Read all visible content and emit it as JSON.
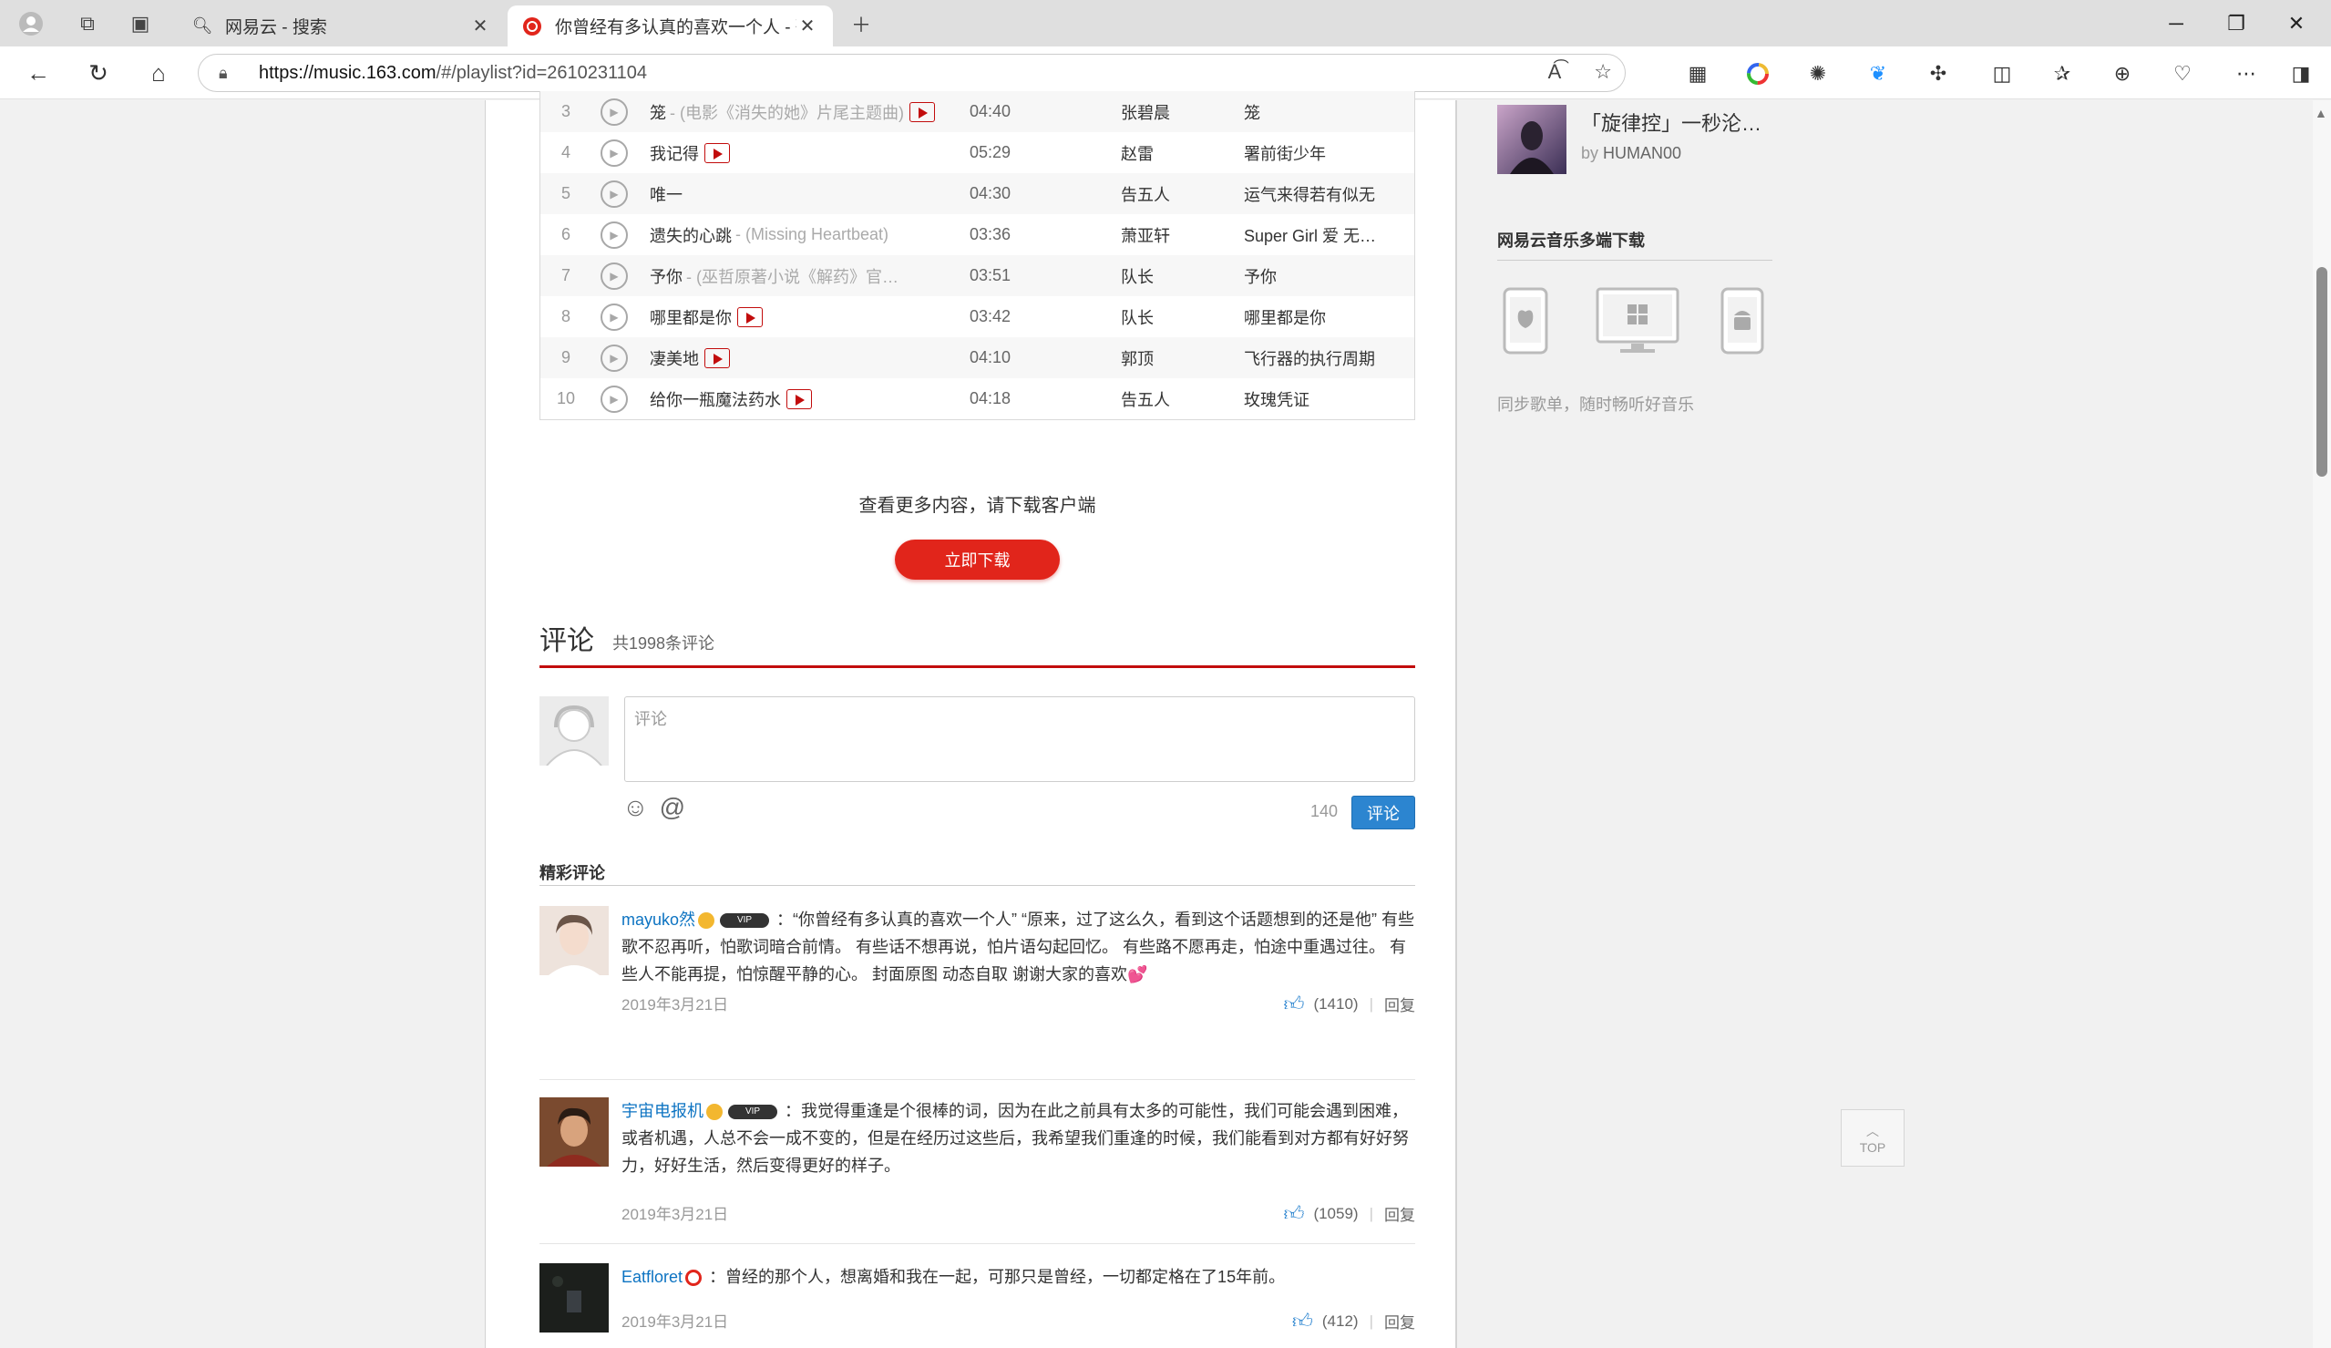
{
  "browser": {
    "tabs": [
      {
        "title": "网易云 - 搜索",
        "icon": "search-icon",
        "active": false
      },
      {
        "title": "你曾经有多认真的喜欢一个人 - 歌",
        "icon": "netease-logo-icon",
        "active": true
      }
    ],
    "url_host": "https://music.163.com",
    "url_rest": "/#/playlist?id=2610231104"
  },
  "songs": [
    {
      "num": "3",
      "title": "笼",
      "alias": "- (电影《消失的她》片尾主题曲)",
      "mv": true,
      "duration": "04:40",
      "artist": "张碧晨",
      "album": "笼"
    },
    {
      "num": "4",
      "title": "我记得",
      "alias": "",
      "mv": true,
      "duration": "05:29",
      "artist": "赵雷",
      "album": "署前街少年"
    },
    {
      "num": "5",
      "title": "唯一",
      "alias": "",
      "mv": false,
      "duration": "04:30",
      "artist": "告五人",
      "album": "运气来得若有似无"
    },
    {
      "num": "6",
      "title": "遗失的心跳",
      "alias": "- (Missing Heartbeat)",
      "mv": false,
      "duration": "03:36",
      "artist": "萧亚轩",
      "album": "Super Girl 爱 无…"
    },
    {
      "num": "7",
      "title": "予你",
      "alias": "- (巫哲原著小说《解药》官…",
      "mv": false,
      "duration": "03:51",
      "artist": "队长",
      "album": "予你"
    },
    {
      "num": "8",
      "title": "哪里都是你",
      "alias": "",
      "mv": true,
      "duration": "03:42",
      "artist": "队长",
      "album": "哪里都是你"
    },
    {
      "num": "9",
      "title": "凄美地",
      "alias": "",
      "mv": true,
      "duration": "04:10",
      "artist": "郭顶",
      "album": "飞行器的执行周期"
    },
    {
      "num": "10",
      "title": "给你一瓶魔法药水",
      "alias": "",
      "mv": true,
      "duration": "04:18",
      "artist": "告五人",
      "album": "玫瑰凭证"
    }
  ],
  "more": {
    "text": "查看更多内容，请下载客户端",
    "button": "立即下载"
  },
  "comments_section": {
    "heading": "评论",
    "count": "共1998条评论",
    "placeholder": "评论",
    "remaining": "140",
    "submit": "评论",
    "best_title": "精彩评论"
  },
  "comments": [
    {
      "user": "mayuko然",
      "text": "：“你曾经有多认真的喜欢一个人” “原来，过了这么久，看到这个话题想到的还是他” 有些歌不忍再听，怕歌词暗合前情。 有些话不想再说，怕片语勾起回忆。 有些路不愿再走，怕途中重遇过往。 有些人不能再提，怕惊醒平静的心。 封面原图 动态自取 谢谢大家的喜欢💕",
      "date": "2019年3月21日",
      "likes": "(1410)",
      "reply": "回复"
    },
    {
      "user": "宇宙电报机",
      "text": "：我觉得重逢是个很棒的词，因为在此之前具有太多的可能性，我们可能会遇到困难，或者机遇，人总不会一成不变的，但是在经历过这些后，我希望我们重逢的时候，我们能看到对方都有好好努力，好好生活，然后变得更好的样子。",
      "date": "2019年3月21日",
      "likes": "(1059)",
      "reply": "回复"
    },
    {
      "user": "Eatfloret",
      "text": "：曾经的那个人，想离婚和我在一起，可那只是曾经，一切都定格在了15年前。",
      "date": "2019年3月21日",
      "likes": "(412)",
      "reply": "回复"
    }
  ],
  "sidebar": {
    "rec_title": "「旋律控」一秒沦陷…",
    "rec_by": "by",
    "rec_user": "HUMAN00",
    "download_head": "网易云音乐多端下载",
    "sync_text": "同步歌单，随时畅听好音乐"
  },
  "totop": "TOP",
  "colors": {
    "brand_red": "#c20c0c",
    "button_red": "#e1251b",
    "link_blue": "#0c73c2",
    "submit_blue": "#2c85d0"
  }
}
